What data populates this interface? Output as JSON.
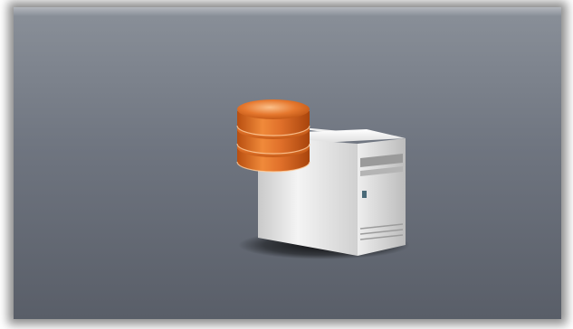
{
  "canvas": {
    "panel_color_top": "#8a9099",
    "panel_color_bottom": "#595e68",
    "frame_color": "#ffffff"
  },
  "illustration": {
    "icon": "database-server-icon",
    "database_color": "#d9691f",
    "server_color": "#e6e6e6"
  }
}
